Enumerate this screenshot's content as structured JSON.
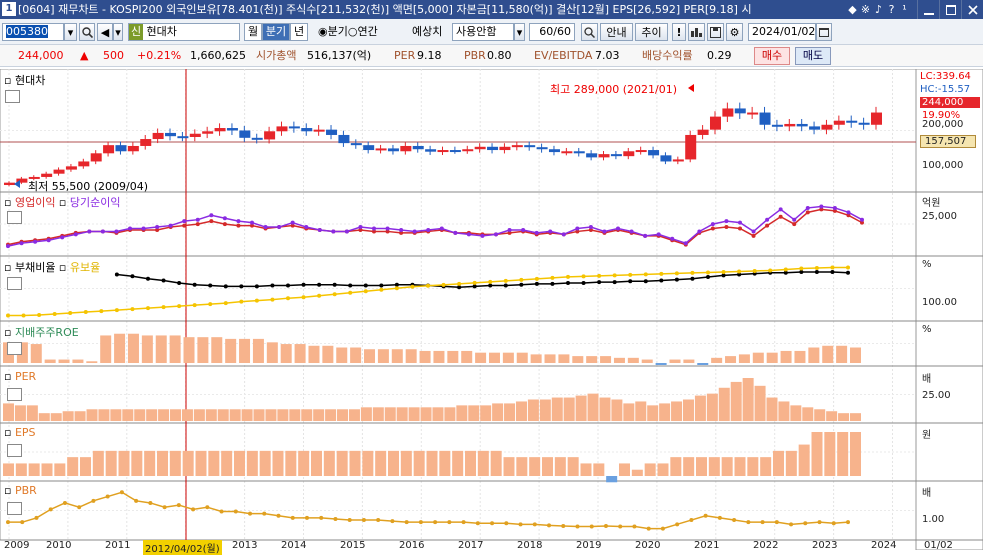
{
  "window": {
    "num": "1",
    "title": "[0604] 재무차트 - KOSPI200 외국인보유[78.401(천)] 주식수[211,532(천)] 액면[5,000] 자본금[11,580(억)] 결산[12월] EPS[26,592] PER[9.18] 시"
  },
  "toolbar": {
    "code": "005380",
    "stock_badge": "신",
    "stock_name": "현대차",
    "tab_month": "월",
    "tab_quarter": "분기",
    "tab_year": "년",
    "radio_quarter": "분기",
    "radio_annual": "연간",
    "forecast_label": "예상치",
    "forecast_value": "사용안함",
    "count": "60/60",
    "guide": "안내",
    "trend": "추이",
    "date": "2024/01/02"
  },
  "info": {
    "price": "244,000",
    "change": "500",
    "rate": "+0.21%",
    "volume": "1,660,625",
    "mcap_label": "시가총액",
    "mcap": "516,137(억)",
    "per_label": "PER",
    "per": "9.18",
    "pbr_label": "PBR",
    "pbr": "0.80",
    "ev_label": "EV/EBITDA",
    "ev": "7.03",
    "div_label": "배당수익률",
    "div": "0.29",
    "buy": "매수",
    "sell": "매도"
  },
  "panels": {
    "p1": "현대차",
    "p2a": "영업이익",
    "p2b": "당기순이익",
    "p3a": "부채비율",
    "p3b": "유보율",
    "p4": "지배주주ROE",
    "p5": "PER",
    "p6": "EPS",
    "p7": "PBR"
  },
  "annot": {
    "high": "최고 289,000 (2021/01)",
    "low": "최저 55,500 (2009/04)"
  },
  "scale": {
    "lc": "LC:339.64",
    "hc": "HC:-15.57",
    "price": "244,000",
    "pct": "19.90%",
    "s200": "200,000",
    "ref": "157,507",
    "s100": "100,000",
    "unit2": "억원",
    "s25000": "25,000",
    "unit3": "%",
    "s100b": "100.00",
    "unit4": "%",
    "unit5": "배",
    "s25": "25.00",
    "unit6": "원",
    "unit7": "배",
    "s1": "1.00",
    "date_end": "01/02"
  },
  "xaxis": [
    "2009",
    "2010",
    "2011",
    "2012/04/02(월)",
    "2013",
    "2014",
    "2015",
    "2016",
    "2017",
    "2018",
    "2019",
    "2020",
    "2021",
    "2022",
    "2023",
    "2024"
  ],
  "colors": {
    "up": "#e6262b",
    "down": "#1f5fc2",
    "op": "#d42a2a",
    "net": "#8a2be2",
    "debt": "#000000",
    "reserve": "#f5c400",
    "bar": "#f7b38c",
    "neg": "#6aa0e0"
  },
  "chart_data": {
    "type": "candlestick",
    "quarters": 60,
    "close": [
      58000,
      68000,
      72000,
      80000,
      90000,
      98000,
      110000,
      130000,
      150000,
      135000,
      148000,
      165000,
      180000,
      172000,
      170000,
      178000,
      184000,
      192000,
      186000,
      168000,
      164000,
      184000,
      196000,
      192000,
      184000,
      188000,
      175000,
      155000,
      150000,
      138000,
      142000,
      135000,
      148000,
      140000,
      134000,
      138000,
      137000,
      140000,
      146000,
      138000,
      146000,
      150000,
      145000,
      140000,
      133000,
      135000,
      130000,
      120000,
      128000,
      123000,
      135000,
      138000,
      125000,
      110000,
      115000,
      175000,
      188000,
      220000,
      240000,
      228000,
      230000,
      200000,
      196000,
      202000,
      196000,
      188000,
      200000,
      210000,
      205000,
      200000,
      230000
    ],
    "op_profit": [
      5,
      7,
      8,
      9,
      11,
      13,
      14,
      14,
      13,
      15,
      15,
      15,
      17,
      18,
      19,
      21,
      19,
      18,
      18,
      16,
      17,
      18,
      16,
      15,
      14,
      14,
      15,
      14,
      14,
      13,
      13,
      14,
      15,
      13,
      13,
      12,
      12,
      13,
      14,
      12,
      13,
      12,
      14,
      15,
      13,
      15,
      13,
      11,
      11,
      8,
      5,
      13,
      16,
      17,
      16,
      11,
      18,
      24,
      19,
      27,
      29,
      28,
      25,
      20
    ],
    "net_profit": [
      4,
      6,
      7,
      8,
      10,
      12,
      14,
      14,
      14,
      16,
      16,
      17,
      18,
      21,
      22,
      25,
      23,
      21,
      20,
      17,
      17,
      20,
      17,
      15,
      14,
      14,
      17,
      16,
      16,
      15,
      14,
      15,
      16,
      13,
      12,
      11,
      12,
      15,
      15,
      13,
      14,
      12,
      16,
      17,
      14,
      16,
      14,
      11,
      12,
      9,
      6,
      14,
      19,
      21,
      20,
      14,
      22,
      29,
      22,
      30,
      31,
      30,
      27,
      22
    ],
    "debt_ratio": [
      null,
      null,
      null,
      null,
      null,
      null,
      null,
      130,
      128,
      125,
      123,
      120,
      118,
      117,
      116,
      116,
      116,
      117,
      117,
      118,
      118,
      118,
      117,
      117,
      117,
      118,
      118,
      117,
      116,
      115,
      116,
      117,
      117,
      118,
      119,
      119,
      120,
      120,
      121,
      121,
      122,
      122,
      123,
      124,
      125,
      127,
      129,
      130,
      131,
      132,
      132,
      133,
      133,
      133,
      132
    ],
    "reserve_ratio": [
      55,
      55,
      56,
      58,
      60,
      62,
      64,
      66,
      68,
      70,
      72,
      74,
      76,
      78,
      80,
      83,
      85,
      87,
      90,
      92,
      95,
      98,
      101,
      104,
      107,
      110,
      113,
      115,
      117,
      119,
      121,
      123,
      125,
      127,
      129,
      131,
      133,
      134,
      135,
      136,
      137,
      138,
      139,
      140,
      141,
      142,
      143,
      144,
      145,
      146,
      148,
      150,
      151,
      152,
      152
    ],
    "roe": [
      12,
      12,
      11,
      2,
      2,
      2,
      1,
      16,
      17,
      17,
      16,
      16,
      16,
      15,
      15,
      15,
      14,
      14,
      14,
      12,
      11,
      11,
      10,
      10,
      9,
      9,
      8,
      8,
      8,
      8,
      7,
      7,
      7,
      7,
      6,
      6,
      6,
      6,
      5,
      5,
      5,
      4,
      4,
      4,
      3,
      3,
      2,
      -1,
      2,
      2,
      -1,
      3,
      4,
      5,
      6,
      6,
      7,
      7,
      9,
      10,
      10,
      9
    ],
    "per": [
      9,
      8,
      8,
      4,
      4,
      5,
      5,
      6,
      6,
      6,
      6,
      6,
      6,
      6,
      6,
      6,
      6,
      6,
      6,
      6,
      6,
      6,
      6,
      6,
      6,
      6,
      6,
      6,
      6,
      6,
      7,
      7,
      7,
      7,
      7,
      7,
      7,
      7,
      8,
      8,
      8,
      9,
      9,
      10,
      11,
      11,
      12,
      12,
      13,
      14,
      12,
      11,
      9,
      10,
      8,
      9,
      10,
      11,
      13,
      14,
      17,
      20,
      22,
      18,
      12,
      10,
      8,
      7,
      6,
      5,
      4,
      4
    ],
    "eps": [
      2,
      2,
      2,
      2,
      2,
      3,
      3,
      4,
      4,
      4,
      4,
      4,
      4,
      4,
      4,
      4,
      4,
      4,
      4,
      4,
      4,
      4,
      4,
      4,
      4,
      4,
      4,
      4,
      4,
      4,
      4,
      4,
      4,
      4,
      4,
      4,
      4,
      4,
      4,
      3,
      3,
      3,
      3,
      3,
      3,
      2,
      2,
      -1,
      2,
      1,
      2,
      2,
      3,
      3,
      3,
      3,
      3,
      3,
      3,
      3,
      4,
      4,
      5,
      7,
      7,
      7,
      7
    ],
    "pbr": [
      0.6,
      0.6,
      0.8,
      1.2,
      1.5,
      1.3,
      1.6,
      1.8,
      2.0,
      1.6,
      1.5,
      1.3,
      1.4,
      1.2,
      1.3,
      1.1,
      1.1,
      1.0,
      1.0,
      0.9,
      0.8,
      0.8,
      0.8,
      0.75,
      0.7,
      0.7,
      0.7,
      0.65,
      0.6,
      0.6,
      0.6,
      0.6,
      0.6,
      0.55,
      0.55,
      0.55,
      0.5,
      0.5,
      0.45,
      0.42,
      0.4,
      0.4,
      0.42,
      0.4,
      0.4,
      0.3,
      0.3,
      0.5,
      0.7,
      0.9,
      0.8,
      0.7,
      0.6,
      0.6,
      0.6,
      0.5,
      0.55,
      0.6,
      0.55,
      0.6
    ]
  }
}
